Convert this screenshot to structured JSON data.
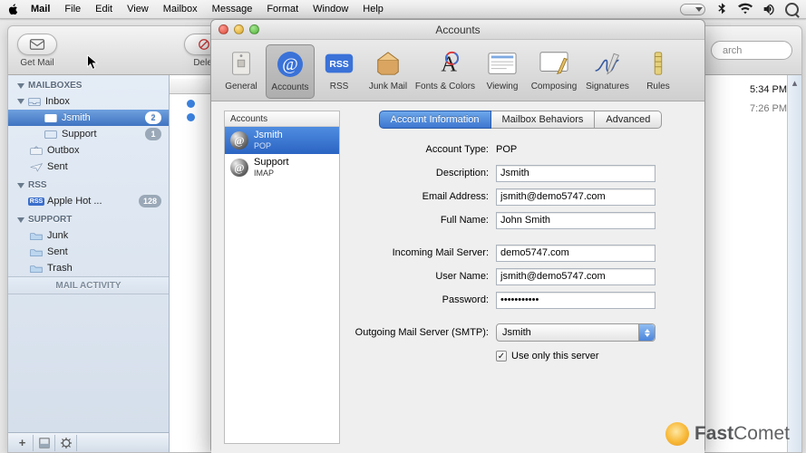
{
  "menubar": {
    "app": "Mail",
    "items": [
      "File",
      "Edit",
      "View",
      "Mailbox",
      "Message",
      "Format",
      "Window",
      "Help"
    ]
  },
  "mail": {
    "toolbar": {
      "getmail": "Get Mail",
      "delete": "Delet",
      "searchLabel": "arch"
    },
    "sidebar": {
      "sec1": "MAILBOXES",
      "inbox": "Inbox",
      "jsmith": "Jsmith",
      "jsmith_badge": "2",
      "support": "Support",
      "support_badge": "1",
      "outbox": "Outbox",
      "sent": "Sent",
      "sec2": "RSS",
      "applehot": "Apple Hot ...",
      "applehot_badge": "128",
      "sec3": "SUPPORT",
      "junk": "Junk",
      "sent2": "Sent",
      "trash": "Trash",
      "activity": "MAIL ACTIVITY"
    },
    "times": {
      "t1": "5:34 PM",
      "t2": "7:26 PM"
    }
  },
  "pref": {
    "title": "Accounts",
    "tb": {
      "general": "General",
      "accounts": "Accounts",
      "rss": "RSS",
      "junk": "Junk Mail",
      "fonts": "Fonts & Colors",
      "viewing": "Viewing",
      "composing": "Composing",
      "signatures": "Signatures",
      "rules": "Rules"
    },
    "list": {
      "header": "Accounts",
      "a1_name": "Jsmith",
      "a1_type": "POP",
      "a2_name": "Support",
      "a2_type": "IMAP"
    },
    "tabs": {
      "info": "Account Information",
      "behaviors": "Mailbox Behaviors",
      "advanced": "Advanced"
    },
    "form": {
      "l_type": "Account Type:",
      "v_type": "POP",
      "l_desc": "Description:",
      "v_desc": "Jsmith",
      "l_email": "Email Address:",
      "v_email": "jsmith@demo5747.com",
      "l_name": "Full Name:",
      "v_name": "John Smith",
      "l_in": "Incoming Mail Server:",
      "v_in": "demo5747.com",
      "l_user": "User Name:",
      "v_user": "jsmith@demo5747.com",
      "l_pass": "Password:",
      "v_pass": "•••••••••••",
      "l_out": "Outgoing Mail Server (SMTP):",
      "v_out": "Jsmith",
      "chk": "Use only this server"
    }
  },
  "watermark": {
    "brand": "Fast",
    "brand2": "Comet"
  }
}
